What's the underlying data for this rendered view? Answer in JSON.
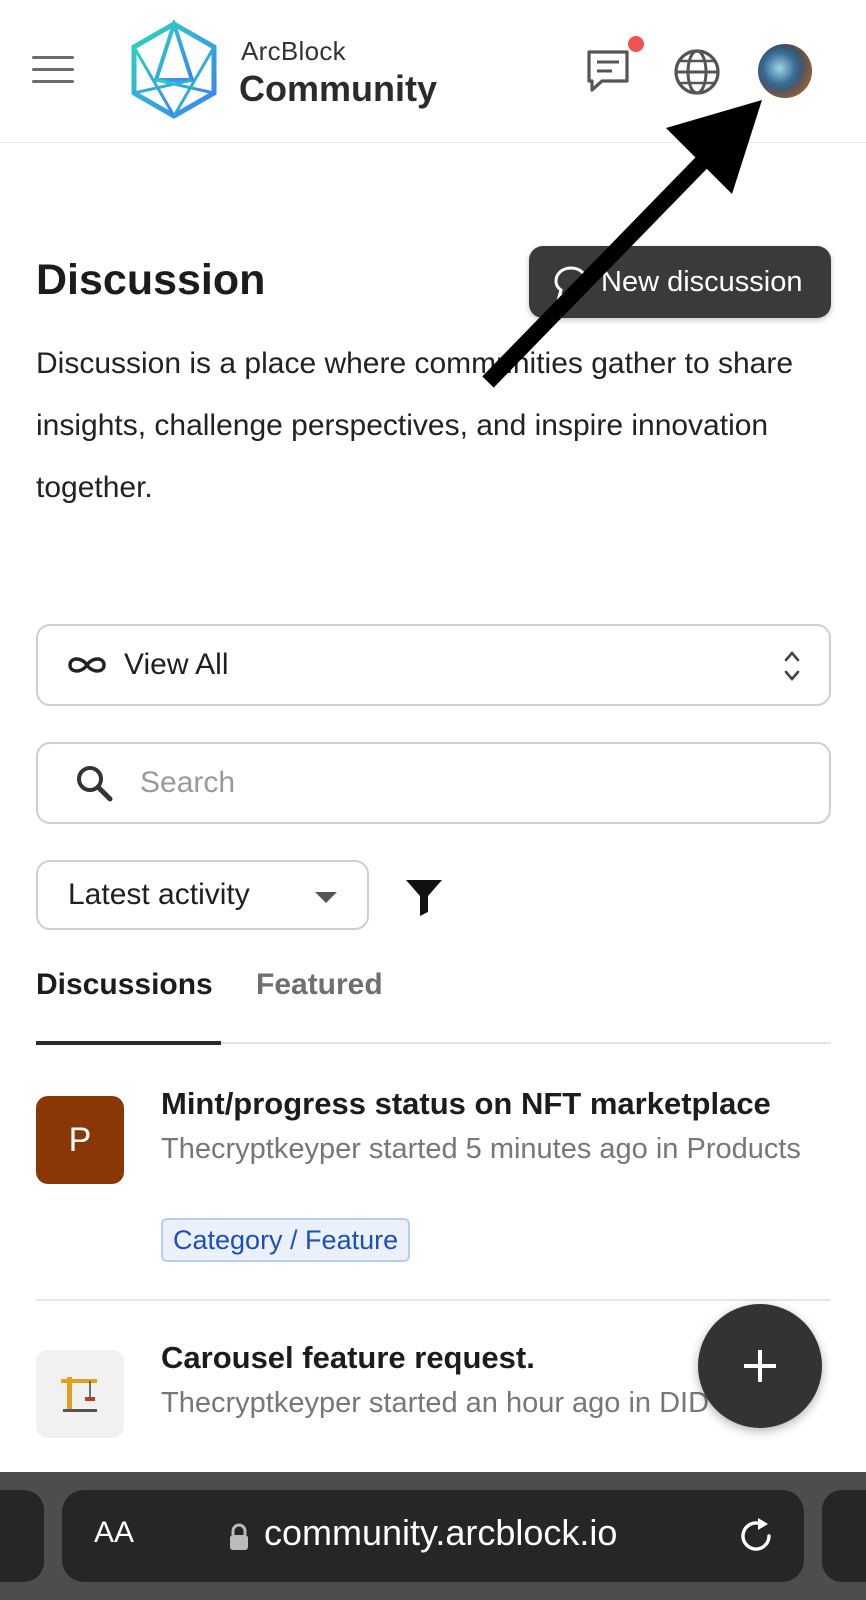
{
  "header": {
    "brand_small": "ArcBlock",
    "brand_big": "Community"
  },
  "hero": {
    "title": "Discussion",
    "new_button": "New discussion",
    "description": "Discussion is a place where communities gather to share insights, challenge perspectives, and inspire innovation together."
  },
  "filters": {
    "view_select": "View All",
    "search_placeholder": "Search",
    "sort_select": "Latest activity"
  },
  "tabs": [
    {
      "label": "Discussions",
      "active": true
    },
    {
      "label": "Featured",
      "active": false
    }
  ],
  "discussions": [
    {
      "avatar_letter": "P",
      "title": "Mint/progress status on NFT marketplace",
      "meta": "Thecryptkeyper started 5 minutes ago in Products",
      "tag": "Category / Feature"
    },
    {
      "avatar_icon": "crane-icon",
      "title": "Carousel feature request.",
      "meta": "Thecryptkeyper started an hour ago in DID Wallet"
    }
  ],
  "browser": {
    "text_size_label": "AA",
    "url": "community.arcblock.io"
  },
  "colors": {
    "notification_dot": "#ef5350",
    "avatar_p_bg": "#8a3706",
    "tag_text": "#1e4fb5",
    "button_dark": "#3a3a3a"
  }
}
